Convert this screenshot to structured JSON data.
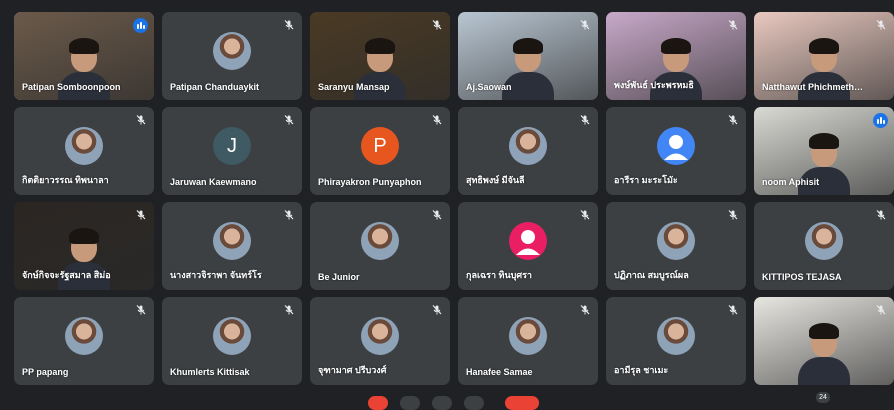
{
  "participants": [
    {
      "name": "Patipan Somboonpoon",
      "type": "video",
      "speaking": true,
      "muted": false,
      "bg": "#6b5a4a"
    },
    {
      "name": "Patipan Chanduaykit",
      "type": "avatar_photo",
      "speaking": false,
      "muted": true
    },
    {
      "name": "Saranyu Mansap",
      "type": "video",
      "speaking": false,
      "muted": true,
      "bg": "#4a3a24"
    },
    {
      "name": "Aj.Saowan",
      "type": "video",
      "speaking": false,
      "muted": true,
      "bg": "#b9c6d2"
    },
    {
      "name": "พงษ์พันธ์ ประพรหมธิ",
      "type": "video",
      "speaking": false,
      "muted": true,
      "bg": "#c8a9c9"
    },
    {
      "name": "Natthawut Phichmethasata",
      "type": "video",
      "speaking": false,
      "muted": true,
      "bg": "#e9c9c0"
    },
    {
      "name": "กิตติยาวรรณ ทิพนาลา",
      "type": "avatar_photo",
      "speaking": false,
      "muted": true
    },
    {
      "name": "Jaruwan Kaewmano",
      "type": "avatar_letter",
      "letter": "J",
      "avatar_color": "#3f5a63",
      "speaking": false,
      "muted": true
    },
    {
      "name": "Phirayakron Punyaphon",
      "type": "avatar_letter",
      "letter": "P",
      "avatar_color": "#e8561f",
      "speaking": false,
      "muted": true
    },
    {
      "name": "สุทธิพงษ์ มีจันลี",
      "type": "avatar_photo",
      "speaking": false,
      "muted": true
    },
    {
      "name": "อารีรา มะระโมัะ",
      "type": "avatar_generic",
      "speaking": false,
      "muted": true
    },
    {
      "name": "noom Aphisit",
      "type": "video",
      "speaking": true,
      "muted": false,
      "bg": "#d9dad4"
    },
    {
      "name": "จักษ์กิจจะรัฐสมาล สิม่อ",
      "type": "video",
      "speaking": false,
      "muted": true,
      "bg": "#2b2622"
    },
    {
      "name": "นางสาวจิราพา จันทร์โร",
      "type": "avatar_photo",
      "speaking": false,
      "muted": true
    },
    {
      "name": "Be Junior",
      "type": "avatar_photo",
      "speaking": false,
      "muted": true
    },
    {
      "name": "กุลเฉรา ทินบุศรา",
      "type": "avatar_generic",
      "avatar_color": "#e91e63",
      "speaking": false,
      "muted": true
    },
    {
      "name": "ปฏิภาณ สมบูรณ์ผล",
      "type": "avatar_photo",
      "speaking": false,
      "muted": true
    },
    {
      "name": "KITTIPOS TEJASA",
      "type": "avatar_photo",
      "speaking": false,
      "muted": true
    },
    {
      "name": "PP papang",
      "type": "avatar_photo",
      "speaking": false,
      "muted": true
    },
    {
      "name": "Khumlerts Kittisak",
      "type": "avatar_photo",
      "speaking": false,
      "muted": true
    },
    {
      "name": "จุฑามาศ ปรีบวงศ์",
      "type": "avatar_photo",
      "speaking": false,
      "muted": true
    },
    {
      "name": "Hanafee Samae",
      "type": "avatar_photo",
      "speaking": false,
      "muted": true
    },
    {
      "name": "อามีรุล ชาเมะ",
      "type": "avatar_photo",
      "speaking": false,
      "muted": true
    },
    {
      "name": "",
      "type": "video",
      "speaking": false,
      "muted": true,
      "bg": "#e7e6e1"
    }
  ],
  "controls": {
    "people_count": "24"
  },
  "colors": {
    "tile_bg": "#3c4043",
    "speaking_badge": "#1a73e8",
    "hangup": "#ea4335"
  }
}
